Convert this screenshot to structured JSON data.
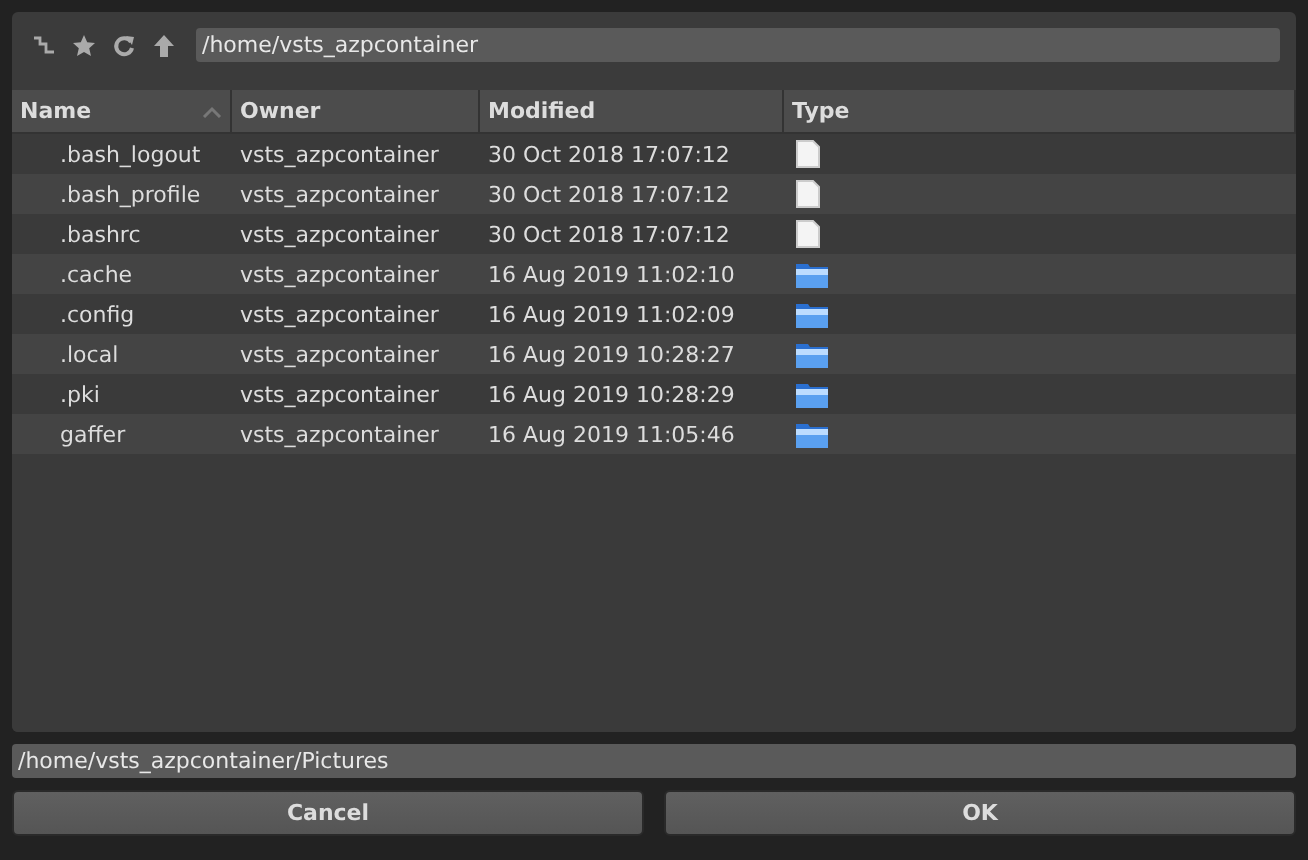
{
  "toolbar": {
    "path": "/home/vsts_azpcontainer"
  },
  "table": {
    "columns": [
      {
        "label": "Name",
        "sorted": true
      },
      {
        "label": "Owner",
        "sorted": false
      },
      {
        "label": "Modified",
        "sorted": false
      },
      {
        "label": "Type",
        "sorted": false
      }
    ],
    "rows": [
      {
        "name": ".bash_logout",
        "owner": "vsts_azpcontainer",
        "modified": "30 Oct 2018 17:07:12",
        "kind": "file"
      },
      {
        "name": ".bash_profile",
        "owner": "vsts_azpcontainer",
        "modified": "30 Oct 2018 17:07:12",
        "kind": "file"
      },
      {
        "name": ".bashrc",
        "owner": "vsts_azpcontainer",
        "modified": "30 Oct 2018 17:07:12",
        "kind": "file"
      },
      {
        "name": ".cache",
        "owner": "vsts_azpcontainer",
        "modified": "16 Aug 2019 11:02:10",
        "kind": "folder"
      },
      {
        "name": ".config",
        "owner": "vsts_azpcontainer",
        "modified": "16 Aug 2019 11:02:09",
        "kind": "folder"
      },
      {
        "name": ".local",
        "owner": "vsts_azpcontainer",
        "modified": "16 Aug 2019 10:28:27",
        "kind": "folder"
      },
      {
        "name": ".pki",
        "owner": "vsts_azpcontainer",
        "modified": "16 Aug 2019 10:28:29",
        "kind": "folder"
      },
      {
        "name": "gaffer",
        "owner": "vsts_azpcontainer",
        "modified": "16 Aug 2019 11:05:46",
        "kind": "folder"
      }
    ]
  },
  "file_path": "/home/vsts_azpcontainer/Pictures",
  "buttons": [
    "Cancel",
    "OK"
  ]
}
